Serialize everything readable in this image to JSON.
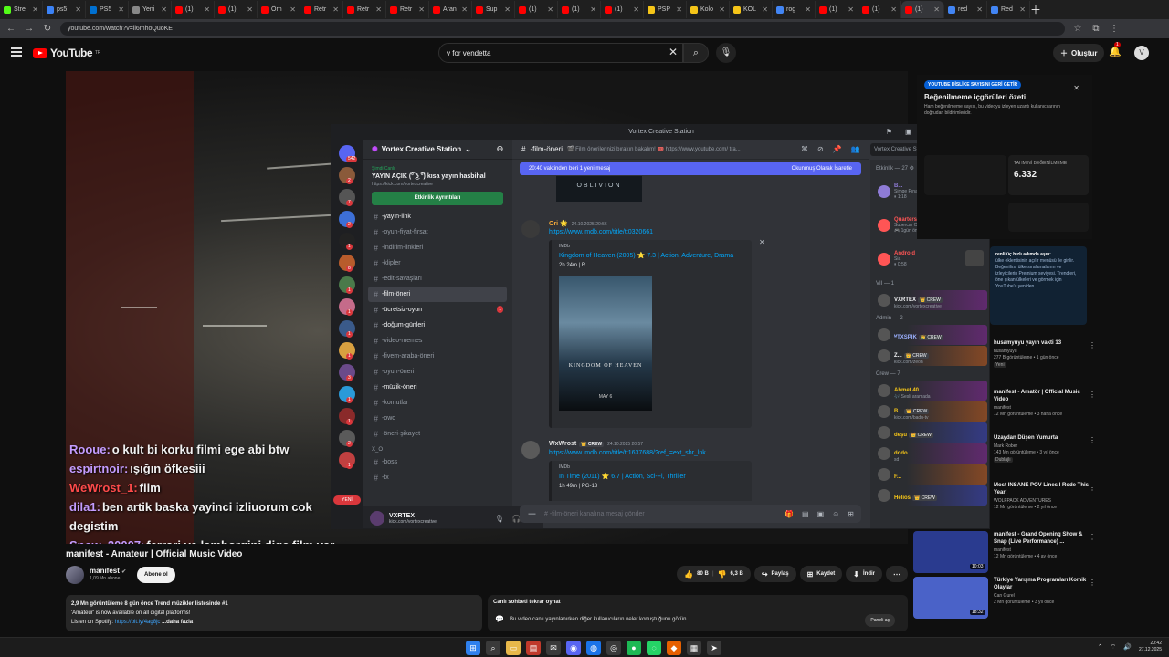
{
  "browser": {
    "tabs": [
      {
        "label": "Stre",
        "color": "#53fc18"
      },
      {
        "label": "ps5",
        "color": "#3b82f6"
      },
      {
        "label": "PS5",
        "color": "#0070d1"
      },
      {
        "label": "Yeni",
        "color": "#888888"
      },
      {
        "label": "(1) ",
        "color": "#ff0000"
      },
      {
        "label": "(1) ",
        "color": "#ff0000"
      },
      {
        "label": "Örn",
        "color": "#ff0000"
      },
      {
        "label": "Retr",
        "color": "#ff0000"
      },
      {
        "label": "Retr",
        "color": "#ff0000"
      },
      {
        "label": "Retr",
        "color": "#ff0000"
      },
      {
        "label": "Aran",
        "color": "#ff0000"
      },
      {
        "label": "Sup",
        "color": "#ff0000"
      },
      {
        "label": "(1) ",
        "color": "#ff0000"
      },
      {
        "label": "(1) ",
        "color": "#ff0000"
      },
      {
        "label": "(1) ",
        "color": "#ff0000"
      },
      {
        "label": "PSP",
        "color": "#f5c518"
      },
      {
        "label": "Kolo",
        "color": "#f5c518"
      },
      {
        "label": "KOL",
        "color": "#f5c518"
      },
      {
        "label": "rog",
        "color": "#4285f4"
      },
      {
        "label": "(1) ",
        "color": "#ff0000"
      },
      {
        "label": "(1) ",
        "color": "#ff0000"
      },
      {
        "label": "(1) ",
        "color": "#ff0000"
      },
      {
        "label": "red",
        "color": "#4285f4"
      },
      {
        "label": "Red",
        "color": "#4285f4"
      }
    ],
    "active_tab_index": 21,
    "url": "youtube.com/watch?v=li6mhoQuoKE"
  },
  "youtube": {
    "logo_text": "YouTube",
    "logo_region": "TR",
    "search_value": "v for vendetta",
    "create_label": "Oluştur",
    "notification_count": "1",
    "avatar_letter": "V",
    "chat_overlay": [
      {
        "user": "Rooue:",
        "user_color": "#c49cff",
        "text": "o kult bi korku filmi ege abi btw"
      },
      {
        "user": "espirtnoir:",
        "user_color": "#c49cff",
        "text": "ışığın öfkesiii"
      },
      {
        "user": "WeWrost_1:",
        "user_color": "#ff4b4b",
        "text": "film"
      },
      {
        "user": "dila1:",
        "user_color": "#c49cff",
        "text": "ben artik baska yayinci izliuorum cok degistim"
      },
      {
        "user": "Snow_20007:",
        "user_color": "#c49cff",
        "text": "ferrari ve lamborgini dige film var onerim @vortexcreativ"
      }
    ],
    "video_title": "manifest - Amateur | Official Music Video",
    "channel_name": "manifest",
    "channel_subs": "1,09 Mn abone",
    "subscribe_label": "Abone ol",
    "likes": "80 B",
    "dislikes": "6,3 B",
    "share_label": "Paylaş",
    "save_label": "Kaydet",
    "download_label": "İndir",
    "description": {
      "stats": "2,9 Mn görüntüleme  8 gün önce  Trend müzikler listesinde #1",
      "line1": "'Amateur' is now available on all digital platforms!",
      "line2_prefix": "Listen on Spotify: ",
      "line2_link": "https://bit.ly/4ag8jc",
      "more": "...daha fazla"
    },
    "chat_replay": {
      "title": "Canlı sohbeti tekrar oynat",
      "text": "Bu video canlı yayınlanırken diğer kullanıcıların neler konuştuğunu görün.",
      "button": "Paneli aç"
    },
    "rd": {
      "badge": "YOUTUBE DİSLİKE SAYISINI GERİ GETİR",
      "title": "Beğenilmeme içgörüleri özeti",
      "text": "Ham beğenilmeme sayısı, bu videoyu izleyen uzantı kullanıcılarının doğrudan bildirimleridir.",
      "metric_label": "TAHMİNİ BEĞENİLMEME",
      "metric_value": "6.332",
      "panel_title": "renli üç hızlı adımda aşın:",
      "panel_text": "ülke eklentisinin açılır menüsü ile girilir. Beğenilirs, ülke sıralamalarını ve izleyicilerin Premium seviyesi. Trendleri, öne çıkan ülkeleri ve görmek için YouTube'u yeniden"
    },
    "recommendations": [
      {
        "title": "husamyuyu yayın vakti 13",
        "channel": "husamyuyu",
        "meta": "277 B görüntüleme • 1 gün önce",
        "badge": "Yeni",
        "duration": "",
        "thumb": "#202020"
      },
      {
        "title": "manifest - Amatör | Official Music Video",
        "channel": "manifest",
        "meta": "12 Mn görüntüleme • 3 hafta önce",
        "badge": "",
        "duration": "",
        "thumb": "#202020"
      },
      {
        "title": "Uzaydan Düşen Yumurta",
        "channel": "Mark Rober",
        "meta": "143 Mn görüntüleme • 3 yıl önce",
        "badge": "Dublajlı",
        "duration": "",
        "thumb": "#202020"
      },
      {
        "title": "Most INSANE POV Lines I Rode This Year!",
        "channel": "WOLFPACK ADVENTURES",
        "meta": "12 Mn görüntüleme • 2 yıl önce",
        "badge": "",
        "duration": "",
        "thumb": "#202020"
      },
      {
        "title": "manifest - Grand Opening Show & Snap (Live Performance) ...",
        "channel": "manifest",
        "meta": "12 Mn görüntüleme • 4 ay önce",
        "badge": "",
        "duration": "10:03",
        "thumb": "#2a3b8f"
      },
      {
        "title": "Türkiye Yarışma Programları Komik Olaylar",
        "channel": "Can Gurel",
        "meta": "2 Mn görüntüleme • 3 yıl önce",
        "badge": "",
        "duration": "18:32",
        "thumb": "#4a62c8"
      }
    ]
  },
  "discord": {
    "window_title": "Vortex Creative Station",
    "server_name": "Vortex Creative Station",
    "server_badges": [
      "542",
      "2",
      "7",
      "2",
      "1",
      "8",
      "1",
      "1",
      "1",
      "1",
      "3",
      "1",
      "1",
      "2",
      "1"
    ],
    "event": {
      "live": "Şimdi Canlı",
      "title": "YAYIN AÇIK (͡° ͜ʖ ͡°) kısa yayın hasbihal",
      "link": "https://kick.com/vortexcreative",
      "button": "Etkinlik Ayrıntıları"
    },
    "channels": [
      {
        "name": "-yayın-link",
        "selected": false,
        "unread": "",
        "bold": true
      },
      {
        "name": "-oyun-fiyat-fırsat",
        "selected": false,
        "unread": "",
        "bold": false
      },
      {
        "name": "-indirim-linkleri",
        "selected": false,
        "unread": "",
        "bold": false
      },
      {
        "name": "-klipler",
        "selected": false,
        "unread": "",
        "bold": false
      },
      {
        "name": "-edit-savaşları",
        "selected": false,
        "unread": "",
        "bold": false
      },
      {
        "name": "-film-öneri",
        "selected": true,
        "unread": "",
        "bold": true
      },
      {
        "name": "-ücretsiz-oyun",
        "selected": false,
        "unread": "1",
        "bold": true
      },
      {
        "name": "-doğum-günleri",
        "selected": false,
        "unread": "",
        "bold": true
      },
      {
        "name": "-video-memes",
        "selected": false,
        "unread": "",
        "bold": false
      },
      {
        "name": "-fivem-araba-öneri",
        "selected": false,
        "unread": "",
        "bold": false
      },
      {
        "name": "-oyun-öneri",
        "selected": false,
        "unread": "",
        "bold": false
      },
      {
        "name": "-müzik-öneri",
        "selected": false,
        "unread": "",
        "bold": true
      },
      {
        "name": "-komutlar",
        "selected": false,
        "unread": "",
        "bold": false
      },
      {
        "name": "-owo",
        "selected": false,
        "unread": "",
        "bold": false
      },
      {
        "name": "-öneri-şikayet",
        "selected": false,
        "unread": "",
        "bold": false
      }
    ],
    "category2": "X_O",
    "channels2": [
      {
        "name": "-boss"
      },
      {
        "name": "-tx"
      }
    ],
    "new_label": "YENİ",
    "user": {
      "name": "VXRTEX",
      "status": "kick.com/vortexcreative"
    },
    "channel_header": "-film-öneri",
    "channel_topic": "🎬 Film önerilerinizi bırakın bakalım! 🎟️ https://www.youtube.com/ tra...",
    "member_search": "Vortex Creative Station sunucus...",
    "new_messages": "20:40 vaktinden beri 1 yeni mesaj",
    "mark_read": "Okunmuş Olarak İşaretle",
    "oblivion_text": "OBLIVION",
    "messages": [
      {
        "author": "Ori 🌟",
        "author_color": "#f2a93b",
        "time": "24.10.2025 20:56",
        "link": "https://www.imdb.com/title/tt0320661",
        "embed_provider": "IMDb",
        "embed_title": "Kingdom of Heaven (2005) ⭐ 7.3 | Action, Adventure, Drama",
        "embed_sub": "2h 24m | R",
        "poster_title": "KINGDOM OF HEAVEN",
        "poster_date": "MAY 6"
      },
      {
        "author": "WxWrost",
        "author_color": "#e0e0e0",
        "crew": "👑 CREW",
        "time": "24.10.2025 20:57",
        "link": "https://www.imdb.com/title/tt1637688/?ref_=ext_shr_lnk",
        "embed_provider": "IMDb",
        "embed_title": "In Time (2011) ⭐ 6.7 | Action, Sci-Fi, Thriller",
        "embed_sub": "1h 49m | PG-13"
      }
    ],
    "input_placeholder": "# -film-öneri kanalına mesaj gönder",
    "events_label": "Etkinlik — 27 ⚙",
    "activity": [
      {
        "name": "B...",
        "sub": "Simge Pınar, Deniz Tekin",
        "sub2": "⏸ 1:18",
        "color": "#8e7bd6"
      },
      {
        "name": "Quarters8",
        "sub": "Supercar Collection Simul...",
        "sub2": "🎮 1gün önce  ⭐ New Player",
        "color": "#ff5555"
      },
      {
        "name": "Android",
        "sub": "Sia",
        "sub2": "⏸ 0:58",
        "color": "#ff5555"
      }
    ],
    "vip_label": "VII — 1",
    "admin_label": "Admin — 2",
    "crew_label": "Crew — 7",
    "vip": [
      {
        "name": "VXRTEX",
        "crew": "👑 CREW",
        "sub": "kick.com/vortexcreative",
        "color": "#f2f3f5",
        "banner": "banner"
      }
    ],
    "admins": [
      {
        "name": "ᴹTXSPIK",
        "crew": "👑 CREW",
        "sub": "",
        "color": "#9bb0ff",
        "banner": "banner"
      },
      {
        "name": "Z...",
        "crew": "👑 CREW",
        "sub": "kick.com/zeon",
        "color": "#f2f3f5",
        "banner": "banner2"
      }
    ],
    "crew": [
      {
        "name": "Ahmet 40",
        "crew": "",
        "sub": "🎶 Sesli aramada",
        "color": "#f5c518",
        "banner": "banner"
      },
      {
        "name": "B...",
        "crew": "👑 CREW",
        "sub": "kick.com/badu-tv",
        "color": "#f5c518",
        "banner": "banner2"
      },
      {
        "name": "deşu",
        "crew": "👑 CREW",
        "sub": "",
        "color": "#f5c518",
        "banner": "banner3"
      },
      {
        "name": "dodo",
        "crew": "",
        "sub": "sd",
        "color": "#f5c518",
        "banner": "banner"
      },
      {
        "name": "F...",
        "crew": "",
        "sub": "",
        "color": "#f5c518",
        "banner": "banner2"
      },
      {
        "name": "Helios",
        "crew": "👑 CREW",
        "sub": "",
        "color": "#f5c518",
        "banner": "banner3"
      }
    ]
  },
  "taskbar": {
    "time": "20:42",
    "date": "27.12.2025",
    "icons": [
      {
        "name": "windows-icon",
        "glyph": "⊞",
        "color": "#2f80ed"
      },
      {
        "name": "search-icon",
        "glyph": "⌕",
        "color": "#3a3a3a"
      },
      {
        "name": "folder-icon",
        "glyph": "▭",
        "color": "#e8b84a"
      },
      {
        "name": "app-icon",
        "glyph": "▤",
        "color": "#c0392b"
      },
      {
        "name": "mail-icon",
        "glyph": "✉",
        "color": "#3a3a3a"
      },
      {
        "name": "discord-icon",
        "glyph": "◉",
        "color": "#5865f2"
      },
      {
        "name": "chrome-icon",
        "glyph": "◍",
        "color": "#1a73e8"
      },
      {
        "name": "steam-icon",
        "glyph": "◎",
        "color": "#3a3a3a"
      },
      {
        "name": "spotify-icon",
        "glyph": "●",
        "color": "#1db954"
      },
      {
        "name": "whatsapp-icon",
        "glyph": "◌",
        "color": "#25d366"
      },
      {
        "name": "firefox-icon",
        "glyph": "◆",
        "color": "#e66000"
      },
      {
        "name": "calc-icon",
        "glyph": "▦",
        "color": "#3a3a3a"
      },
      {
        "name": "arrow-icon",
        "glyph": "➤",
        "color": "#3a3a3a"
      }
    ]
  }
}
